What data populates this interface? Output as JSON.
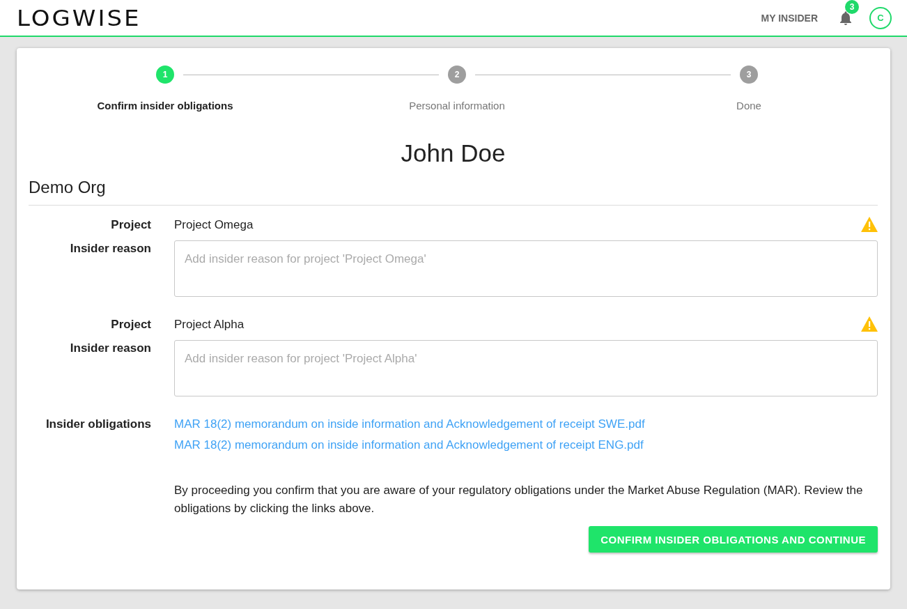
{
  "header": {
    "logo": "LOGWISE",
    "nav_link": "MY INSIDER",
    "notification_count": "3",
    "avatar_initial": "C"
  },
  "stepper": [
    {
      "number": "1",
      "label": "Confirm insider obligations",
      "selected": true
    },
    {
      "number": "2",
      "label": "Personal information",
      "selected": false
    },
    {
      "number": "3",
      "label": "Done",
      "selected": false
    }
  ],
  "person_name": "John Doe",
  "organization": "Demo Org",
  "projects": [
    {
      "project_label": "Project",
      "project_name": "Project Omega",
      "warning": true,
      "reason_label": "Insider reason",
      "placeholder": "Add insider reason for project 'Project Omega'"
    },
    {
      "project_label": "Project",
      "project_name": "Project Alpha",
      "warning": true,
      "reason_label": "Insider reason",
      "placeholder": "Add insider reason for project 'Project Alpha'"
    }
  ],
  "obligations": {
    "label": "Insider obligations",
    "links": [
      "MAR 18(2) memorandum on inside information and Acknowledgement of receipt SWE.pdf",
      "MAR 18(2) memorandum on inside information and Acknowledgement of receipt ENG.pdf"
    ]
  },
  "notice": "By proceeding you confirm that you are aware of your regulatory obligations under the Market Abuse Regulation (MAR). Review the obligations by clicking the links above.",
  "confirm_button": "CONFIRM INSIDER OBLIGATIONS AND CONTINUE"
}
